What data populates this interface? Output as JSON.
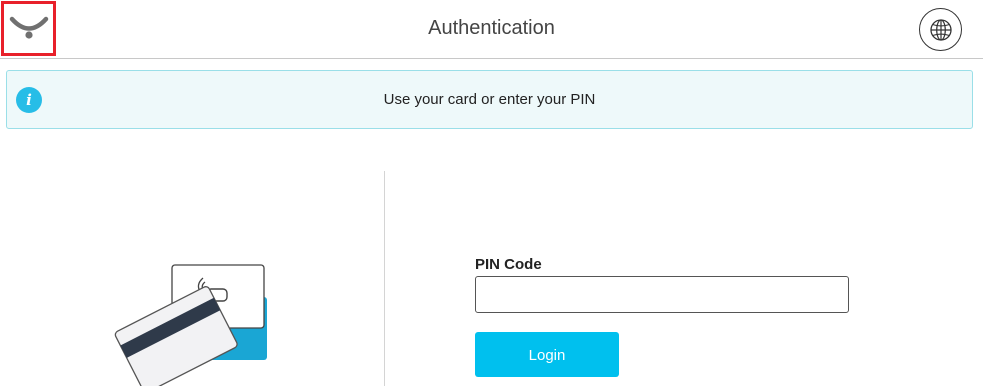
{
  "header": {
    "title": "Authentication",
    "logo_icon": "smile-logo-icon",
    "language_icon": "globe-icon"
  },
  "info_banner": {
    "icon": "info-icon",
    "icon_glyph": "i",
    "message": "Use your card or enter your PIN"
  },
  "card_panel": {
    "illustration": "card-contactless-icon"
  },
  "pin_form": {
    "label": "PIN Code",
    "value": "",
    "placeholder": "",
    "login_label": "Login"
  },
  "colors": {
    "accent": "#00c0ee",
    "info_icon": "#27bde7",
    "info_bg": "#eef9fa",
    "info_border": "#9adfe8",
    "logo_highlight": "#e8202a"
  }
}
